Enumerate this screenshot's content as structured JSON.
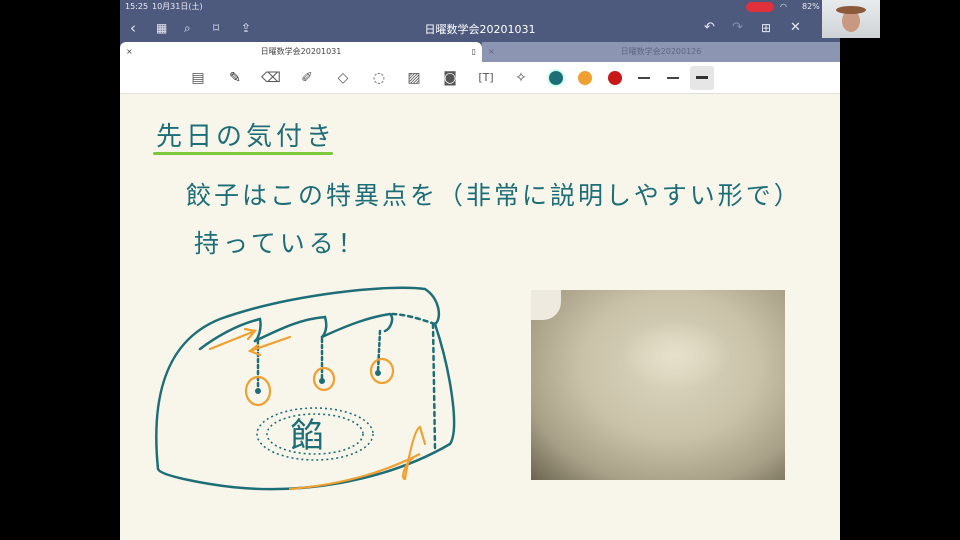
{
  "status": {
    "time": "15:25",
    "date": "10月31日(土)",
    "battery": "82%"
  },
  "nav": {
    "title": "日曜数学会20201031",
    "icons": [
      "back-icon",
      "grid-icon",
      "search-icon",
      "bookmark-icon",
      "share-icon",
      "undo-icon",
      "redo-icon",
      "add-page-icon",
      "close-icon"
    ]
  },
  "tabs": [
    {
      "label": "日曜数学会20201031",
      "active": true
    },
    {
      "label": "日曜数学会20200126",
      "active": false
    }
  ],
  "toolbar": {
    "tools": [
      "page-tool-icon",
      "pen-icon",
      "eraser-icon",
      "highlighter-icon",
      "shapes-icon",
      "lasso-icon",
      "image-icon",
      "camera-icon",
      "textbox-icon",
      "laser-pointer-icon"
    ],
    "colors": [
      "#1e6e78",
      "#f0a030",
      "#c81818"
    ],
    "selected_color": "#1e6e78",
    "stroke_widths": [
      "thin",
      "medium",
      "thick"
    ],
    "selected_width": "thick"
  },
  "note": {
    "heading": "先日の気付き",
    "line1": "餃子はこの特異点を（非常に説明しやすい形で）",
    "line2": "持っている！",
    "diagram_label": "餡",
    "ink": "#1e6e78",
    "underline": "#7cc83a",
    "accent": "#f0a030"
  }
}
